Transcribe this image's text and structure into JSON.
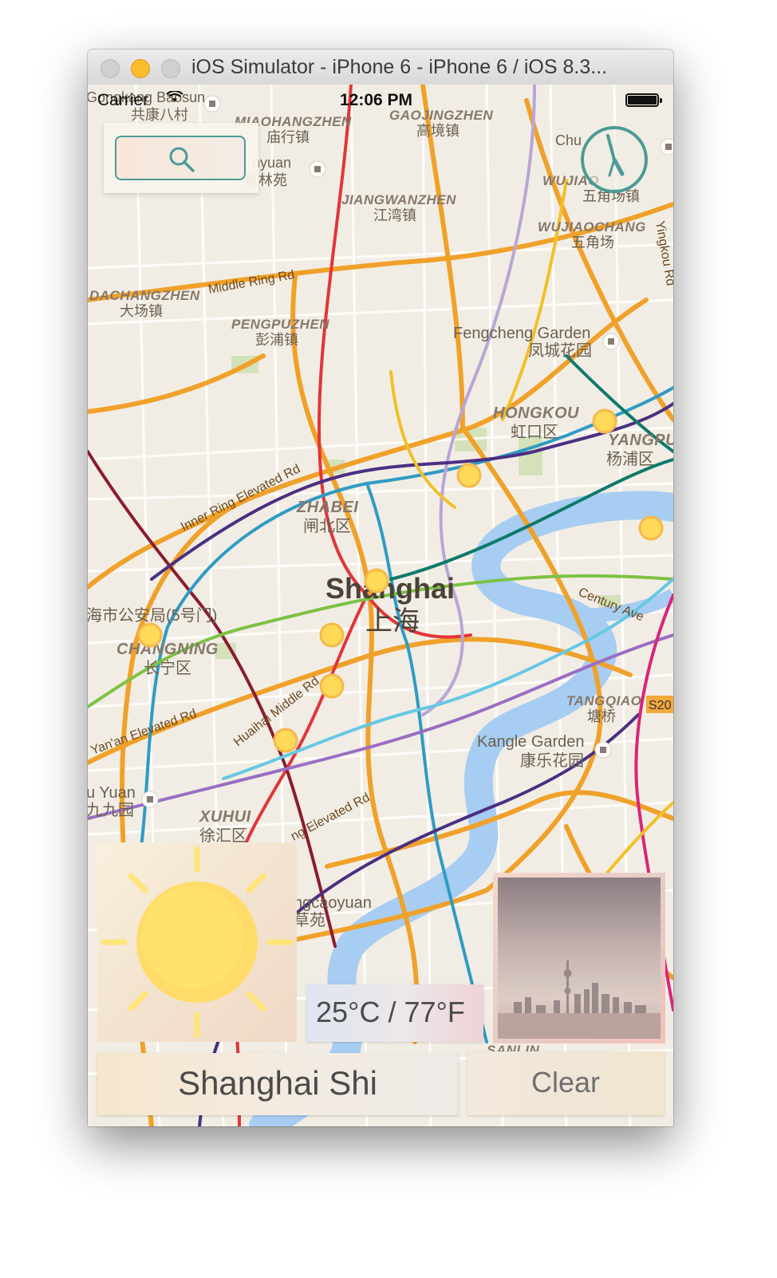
{
  "window": {
    "title": "iOS Simulator - iPhone 6 - iPhone 6 / iOS 8.3..."
  },
  "status_bar": {
    "carrier": "Carrier",
    "time": "12:06 PM"
  },
  "map": {
    "labels": {
      "baoshan": "Gongkang Baosun",
      "baoshan_cn": "共康八村",
      "miaohangzhen": "MIAOHANGZHEN",
      "miaohangzhen_cn": "庙行镇",
      "gaojingzhen": "GAOJINGZHEN",
      "gaojingzhen_cn": "高境镇",
      "jiangwanzhen": "JIANGWANZHEN",
      "jiangwanzhen_cn": "江湾镇",
      "wujiaochang": "WUJIAOCHANG",
      "wujiaochang_cn": "五角场",
      "dachangzhen": "DACHANGZHEN",
      "dachangzhen_cn": "大场镇",
      "pengpuzhen": "PENGPUZHEN",
      "pengpuzhen_cn": "彭浦镇",
      "middle_ring": "Middle Ring Rd",
      "fengcheng": "Fengcheng Garden",
      "fengcheng_cn": "凤城花园",
      "hongkou": "HONGKOU",
      "hongkou_cn": "虹口区",
      "yangpu": "YANGPU",
      "yangpu_cn": "杨浦区",
      "inner_ring": "Inner Ring Elevated Rd",
      "zhabei": "ZHABEI",
      "zhabei_cn": "闸北区",
      "shanghai": "Shanghai",
      "shanghai_cn": "上海",
      "police": "海市公安局(5号门)",
      "changning": "CHANGNING",
      "changning_cn": "长宁区",
      "century_ave": "Century Ave",
      "tangqiao": "TANGQIAO",
      "tangqiao_cn": "塘桥",
      "yanan": "Yan'an Elevated Rd",
      "huaihai": "Huaihai Middle Rd",
      "kangle": "Kangle Garden",
      "kangle_cn": "康乐花园",
      "jiuyuan": "u Yuan",
      "jiuyuan_cn": "九九园",
      "xuhui": "XUHUI",
      "xuhui_cn": "徐汇区",
      "luban": "ng Elevated Rd",
      "longcaoyuan": "ngcaoyuan",
      "longcaoyuan_cn": "草苑",
      "s20": "S20",
      "sanlin": "SANLIN",
      "chu": "Chu",
      "yingkou": "Yingkou Rd",
      "nyuan": "nyuan",
      "nyuan_cn": "星林苑",
      "wujiao2": "WUJIAO",
      "wujiao2_cn": "五角场镇"
    }
  },
  "search": {
    "icon": "search-icon"
  },
  "clock_button": {
    "icon": "clock-icon"
  },
  "weather": {
    "icon": "sun-icon",
    "temperature": "25°C / 77°F",
    "photo_alt": "shanghai-skyline-photo"
  },
  "city_field": {
    "value": "Shanghai Shi"
  },
  "clear_button": {
    "label": "Clear"
  },
  "colors": {
    "map_land": "#f2ede4",
    "water": "#a7cdf2",
    "accent_teal": "#4a9b96",
    "sun_yellow": "#ffdd61",
    "sun_orange": "#fbb04b"
  }
}
